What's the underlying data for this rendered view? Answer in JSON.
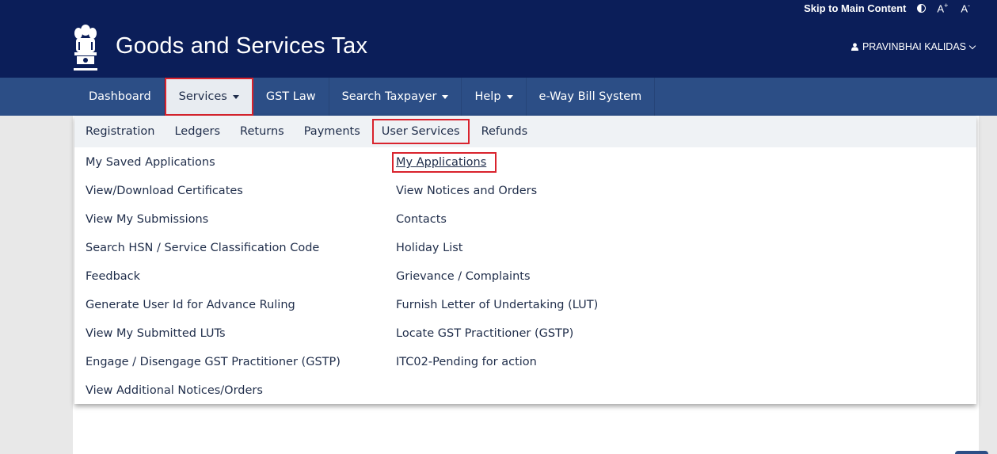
{
  "topbar": {
    "skip_label": "Skip to Main Content",
    "font_increase": "A",
    "font_decrease": "A",
    "plus": "+",
    "minus": "-"
  },
  "header": {
    "title": "Goods and Services Tax",
    "user_name": "PRAVINBHAI KALIDAS"
  },
  "nav": {
    "items": [
      {
        "label": "Dashboard"
      },
      {
        "label": "Services"
      },
      {
        "label": "GST Law"
      },
      {
        "label": "Search Taxpayer"
      },
      {
        "label": "Help"
      },
      {
        "label": "e-Way Bill System"
      }
    ]
  },
  "subnav": {
    "items": [
      {
        "label": "Registration"
      },
      {
        "label": "Ledgers"
      },
      {
        "label": "Returns"
      },
      {
        "label": "Payments"
      },
      {
        "label": "User Services"
      },
      {
        "label": "Refunds"
      }
    ]
  },
  "menu": {
    "left": [
      "My Saved Applications",
      "View/Download Certificates",
      "View My Submissions",
      "Search HSN / Service Classification Code",
      "Feedback",
      "Generate User Id for Advance Ruling",
      "View My Submitted LUTs",
      "Engage / Disengage GST Practitioner (GSTP)",
      "View Additional Notices/Orders"
    ],
    "right": [
      "My Applications",
      "View Notices and Orders",
      "Contacts",
      "Holiday List",
      "Grievance / Complaints",
      "Furnish Letter of Undertaking (LUT)",
      "Locate GST Practitioner (GSTP)",
      "ITC02-Pending for action"
    ]
  },
  "colors": {
    "header_bg": "#0b1e59",
    "nav_bg": "#2c4e86",
    "highlight": "#d9232d",
    "text": "#1f2d4a"
  },
  "icons": {
    "contrast": "contrast-icon",
    "user": "user-icon",
    "emblem": "emblem-icon"
  }
}
